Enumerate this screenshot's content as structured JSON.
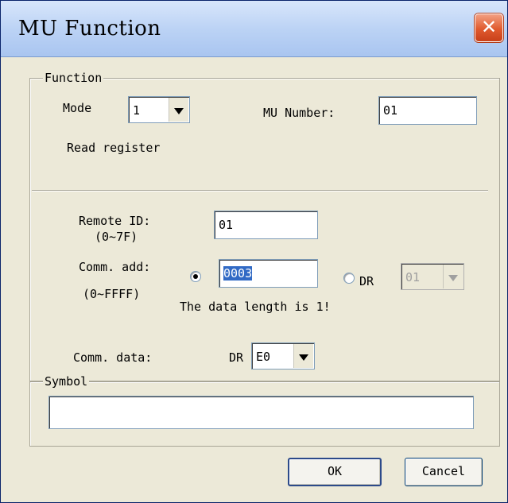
{
  "window": {
    "title": "MU Function",
    "close_glyph": "✕"
  },
  "function_group": {
    "legend": "Function",
    "mode_label": "Mode",
    "mode_value": "1",
    "mu_number_label": "MU Number:",
    "mu_number_value": "01",
    "description": "Read register"
  },
  "remote": {
    "remote_id_label": "Remote ID:",
    "remote_id_range": "(0~7F)",
    "remote_id_value": "01",
    "comm_add_label": "Comm. add:",
    "comm_add_range": "(0~FFFF)",
    "comm_add_value": "0003",
    "dr_label": "DR",
    "dr_value": "01",
    "data_length_note": "The data length is 1!",
    "comm_data_label": "Comm. data:",
    "comm_data_dr_label": "DR",
    "comm_data_value": "E0"
  },
  "symbol": {
    "legend": "Symbol",
    "value": ""
  },
  "buttons": {
    "ok": "OK",
    "cancel": "Cancel"
  }
}
